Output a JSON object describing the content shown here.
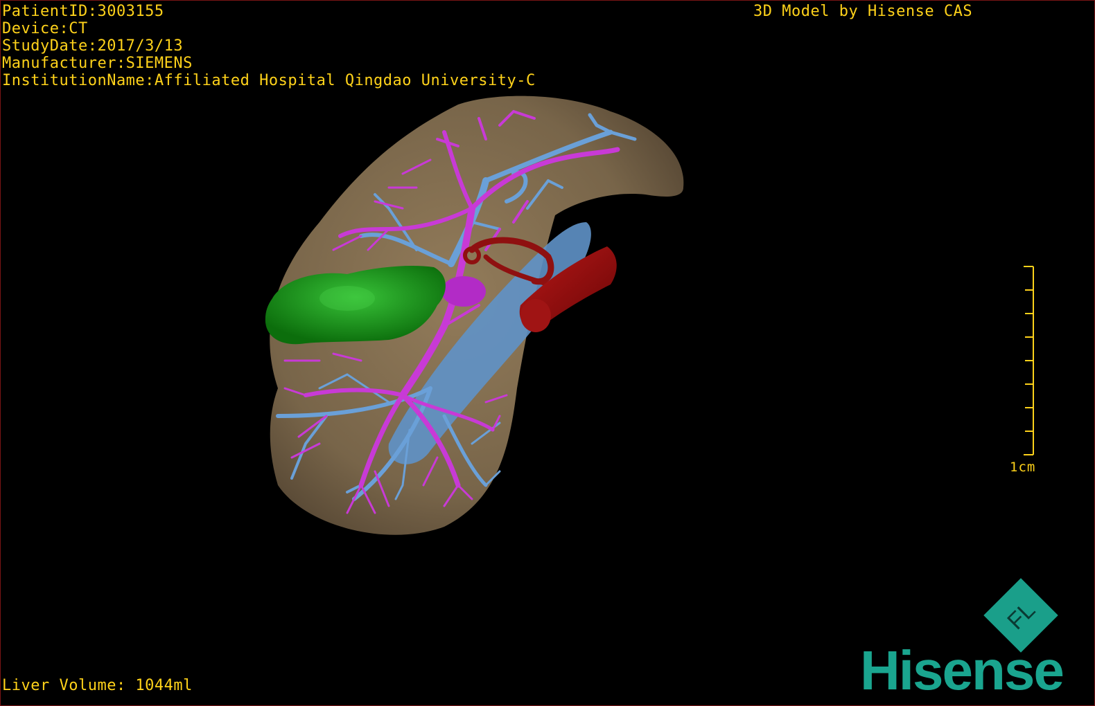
{
  "header": {
    "patient_id": "PatientID:3003155",
    "device": "Device:CT",
    "study_date": "StudyDate:2017/3/13",
    "manufacturer": "Manufacturer:SIEMENS",
    "institution": "InstitutionName:Affiliated Hospital Qingdao University-C"
  },
  "brand_credit": "3D Model by Hisense CAS",
  "scale": {
    "label": "1cm"
  },
  "footer": {
    "liver_volume": "Liver Volume: 1044ml"
  },
  "logo": {
    "mark_letters": "FL",
    "word": "Hisense"
  },
  "colors": {
    "overlay_text": "#ffd21a",
    "liver": "#8a7254",
    "portal_vein": "#6aa0d8",
    "hepatic_artery_branches": "#c83ad6",
    "tumor": "#1f9a1f",
    "aorta": "#9a1010",
    "logo": "#1aa58f"
  }
}
